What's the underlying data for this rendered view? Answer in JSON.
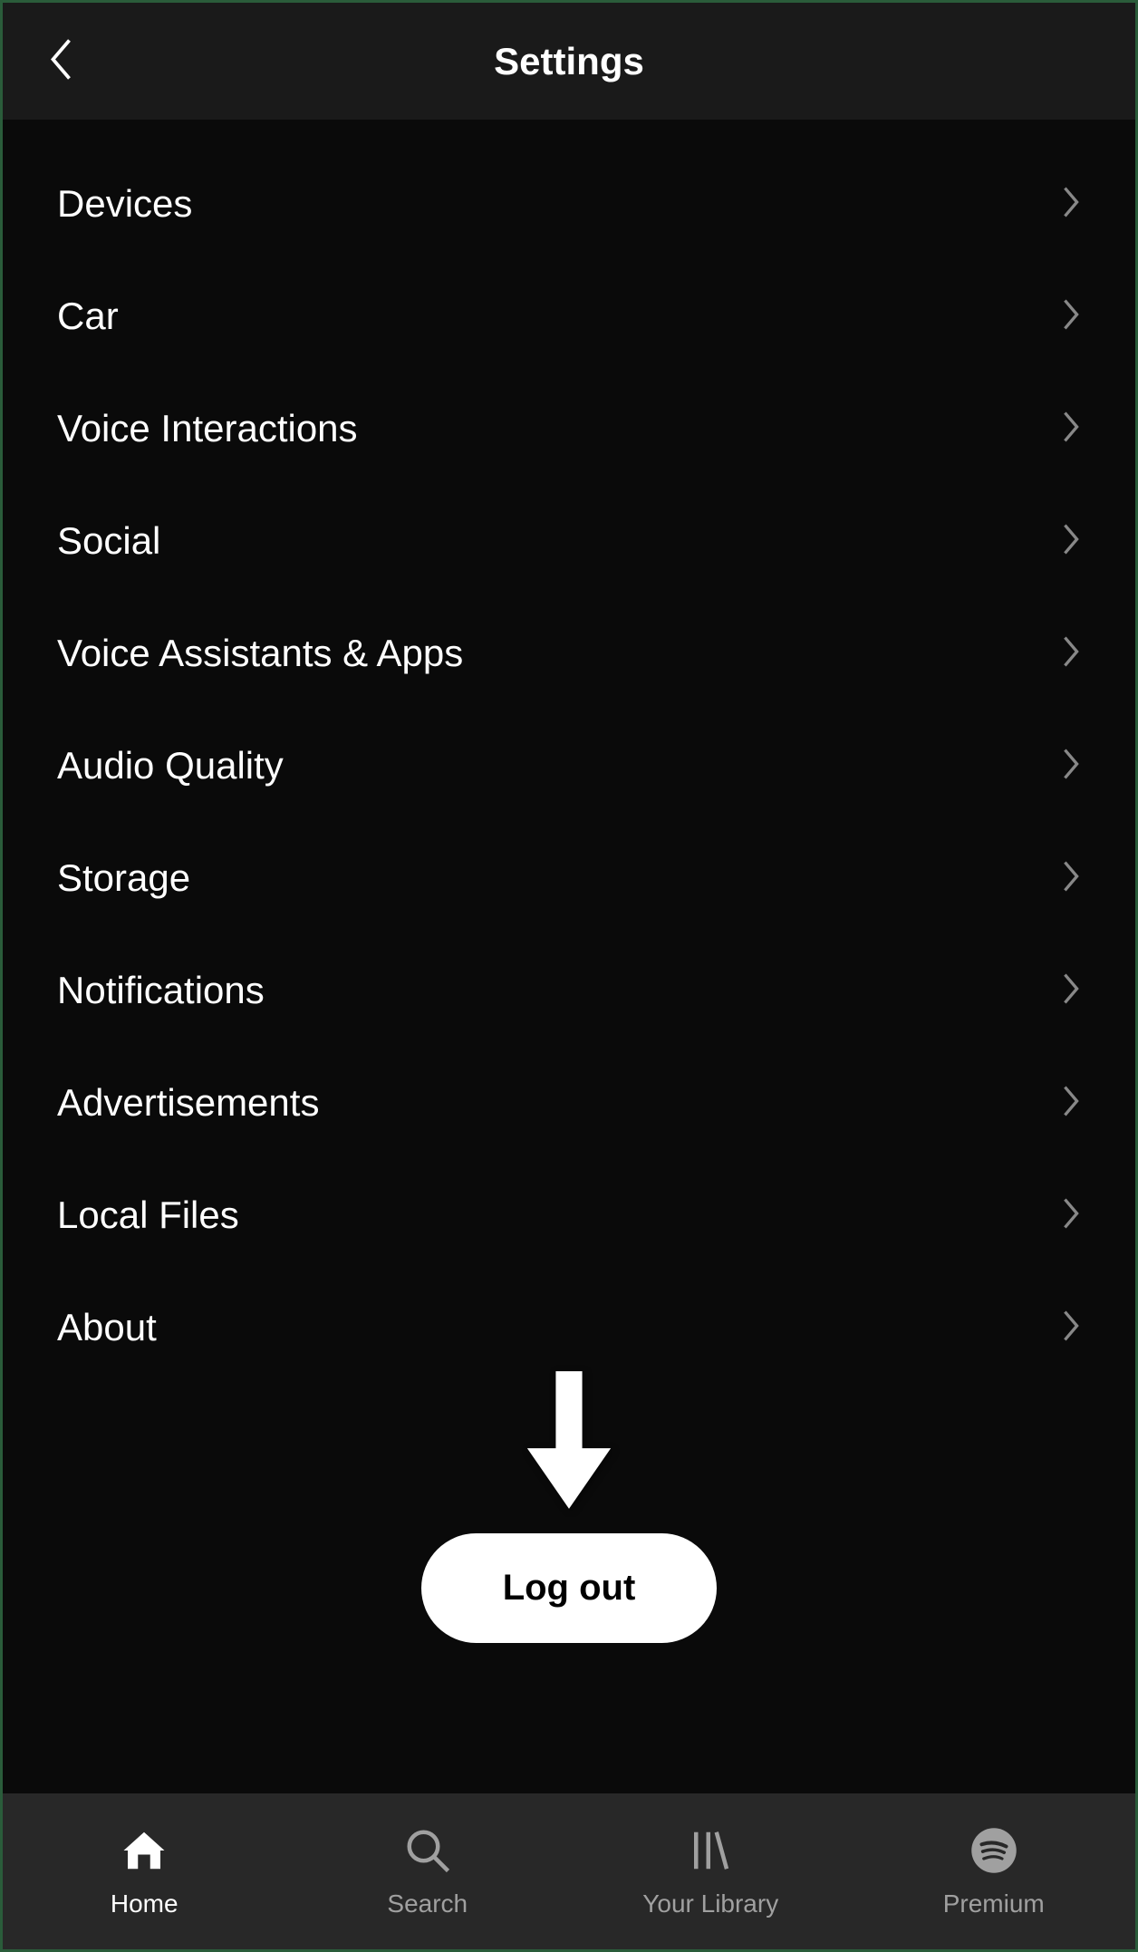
{
  "header": {
    "title": "Settings"
  },
  "settings_items": [
    {
      "label": "Devices"
    },
    {
      "label": "Car"
    },
    {
      "label": "Voice Interactions"
    },
    {
      "label": "Social"
    },
    {
      "label": "Voice Assistants & Apps"
    },
    {
      "label": "Audio Quality"
    },
    {
      "label": "Storage"
    },
    {
      "label": "Notifications"
    },
    {
      "label": "Advertisements"
    },
    {
      "label": "Local Files"
    },
    {
      "label": "About"
    }
  ],
  "logout": {
    "label": "Log out"
  },
  "bottom_nav": [
    {
      "label": "Home",
      "icon": "home-icon",
      "active": true
    },
    {
      "label": "Search",
      "icon": "search-icon",
      "active": false
    },
    {
      "label": "Your Library",
      "icon": "library-icon",
      "active": false
    },
    {
      "label": "Premium",
      "icon": "spotify-icon",
      "active": false
    }
  ]
}
